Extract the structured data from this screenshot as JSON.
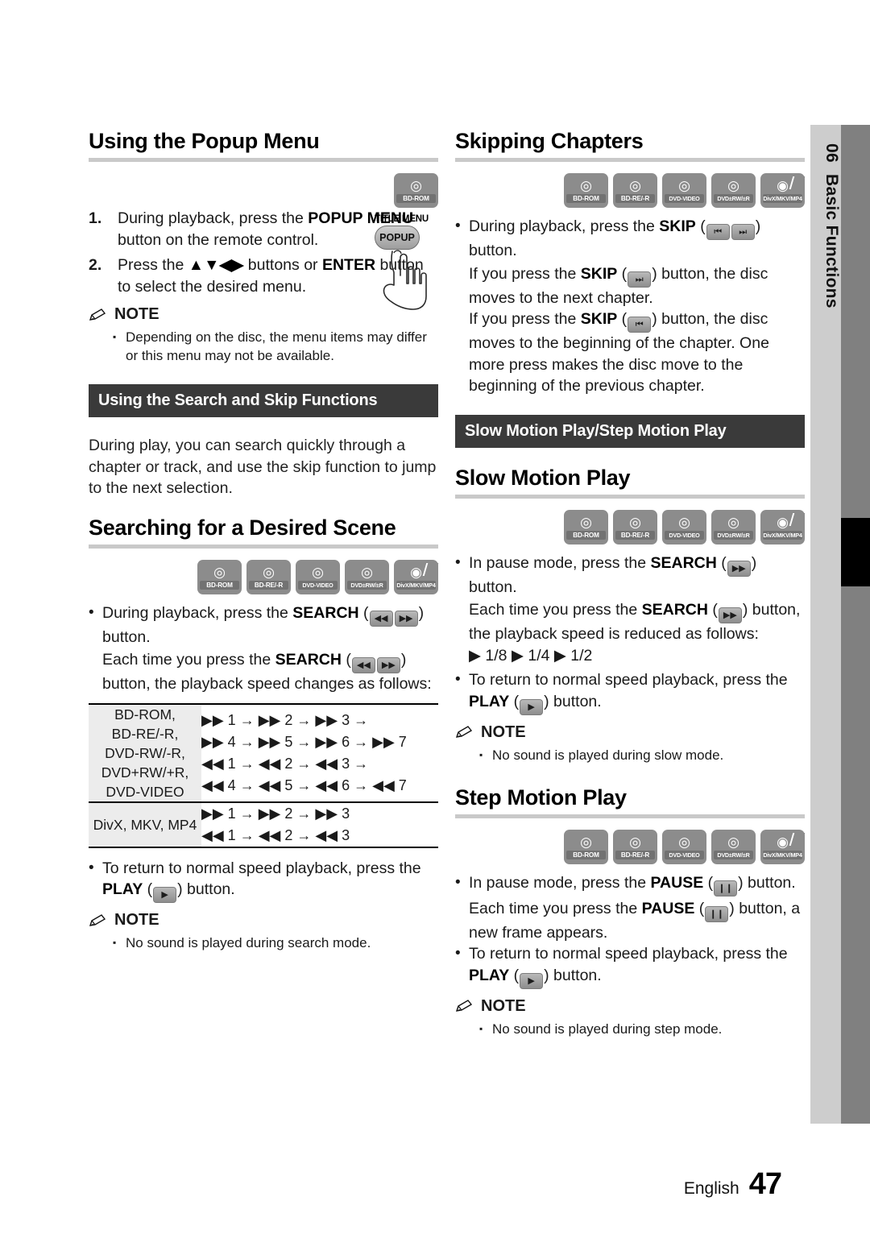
{
  "page": {
    "chapter_number": "06",
    "chapter_name": "Basic Functions",
    "language": "English",
    "page_number": "47"
  },
  "left_column": {
    "section1": {
      "title": "Using the Popup Menu",
      "disc_icons": [
        "BD-ROM"
      ],
      "steps": [
        {
          "num": "1.",
          "text_a": "During playback, press the ",
          "bold_a": "POPUP MENU",
          "text_b": " button on the remote control."
        },
        {
          "num": "2.",
          "text_a": "Press the ",
          "arrows": "▲▼◀▶",
          "text_b": " buttons or ",
          "bold_b": "ENTER",
          "text_c": " button to select the desired menu."
        }
      ],
      "remote_graphic": {
        "label": "TITLE MENU",
        "button": "POPUP"
      },
      "note": {
        "heading": "NOTE",
        "items": [
          "Depending on the disc, the menu items may differ or this menu may not be available."
        ]
      }
    },
    "section2": {
      "bar_title": "Using the Search and Skip Functions",
      "intro": "During play, you can search quickly through a chapter or track, and use the skip function to jump to the next selection."
    },
    "section3": {
      "title": "Searching for a Desired Scene",
      "disc_icons": [
        "BD-ROM",
        "BD-RE/-R",
        "DVD-VIDEO",
        "DVD±RW/±R",
        "DivX/MKV/MP4"
      ],
      "bullets": [
        {
          "pre": "During playback, press the ",
          "bold": "SEARCH",
          "keys": [
            "rewind",
            "fastforward"
          ],
          "post": " button."
        }
      ],
      "sub_line": {
        "pre": "Each time you press the ",
        "bold": "SEARCH",
        "keys": [
          "rewind",
          "fastforward"
        ],
        "post": " button, the playback speed changes as follows:"
      },
      "speed_table": {
        "rows": [
          {
            "category": "BD-ROM,\nBD-RE/-R,\nDVD-RW/-R,\nDVD+RW/+R,\nDVD-VIDEO",
            "sequences": [
              "▶▶ 1 → ▶▶ 2 → ▶▶ 3 →",
              "▶▶ 4 → ▶▶ 5 → ▶▶ 6 → ▶▶ 7",
              "◀◀ 1 → ◀◀ 2 → ◀◀ 3 →",
              "◀◀ 4 → ◀◀ 5 → ◀◀ 6 → ◀◀ 7"
            ]
          },
          {
            "category": "DivX, MKV, MP4",
            "sequences": [
              "▶▶ 1 → ▶▶ 2 → ▶▶ 3",
              "◀◀ 1 → ◀◀ 2 → ◀◀ 3"
            ]
          }
        ]
      },
      "return_bullet": {
        "pre": "To return to normal speed playback, press the ",
        "bold": "PLAY",
        "keys": [
          "play"
        ],
        "post": " button."
      },
      "note": {
        "heading": "NOTE",
        "items": [
          "No sound is played during search mode."
        ]
      }
    }
  },
  "right_column": {
    "section1": {
      "title": "Skipping Chapters",
      "disc_icons": [
        "BD-ROM",
        "BD-RE/-R",
        "DVD-VIDEO",
        "DVD±RW/±R",
        "DivX/MKV/MP4"
      ],
      "bullet": {
        "pre": "During playback, press the ",
        "bold": "SKIP",
        "keys": [
          "skipback",
          "skipfwd"
        ],
        "post": " button."
      },
      "lines": [
        {
          "pre": "If you press the ",
          "bold": "SKIP",
          "keys": [
            "skipfwd"
          ],
          "post": " button, the disc moves to the next chapter."
        },
        {
          "pre": "If you press the ",
          "bold": "SKIP",
          "keys": [
            "skipback"
          ],
          "post": " button, the disc moves to the beginning of the chapter. One more press makes the disc move to the beginning of the previous chapter."
        }
      ]
    },
    "section2": {
      "bar_title": "Slow Motion Play/Step Motion Play"
    },
    "section3": {
      "title": "Slow Motion Play",
      "disc_icons": [
        "BD-ROM",
        "BD-RE/-R",
        "DVD-VIDEO",
        "DVD±RW/±R",
        "DivX/MKV/MP4"
      ],
      "bullet": {
        "pre": "In pause mode, press the ",
        "bold": "SEARCH",
        "keys": [
          "fastforward"
        ],
        "post": " button."
      },
      "sub_line": {
        "pre": "Each time you press the ",
        "bold": "SEARCH",
        "keys": [
          "fastforward"
        ],
        "post": " button, the playback speed is reduced as follows:"
      },
      "speeds": "▶ 1/8 ▶ 1/4 ▶ 1/2",
      "return_bullet": {
        "pre": "To return to normal speed playback, press the ",
        "bold": "PLAY",
        "keys": [
          "play"
        ],
        "post": " button."
      },
      "note": {
        "heading": "NOTE",
        "items": [
          "No sound is played during slow mode."
        ]
      }
    },
    "section4": {
      "title": "Step Motion Play",
      "disc_icons": [
        "BD-ROM",
        "BD-RE/-R",
        "DVD-VIDEO",
        "DVD±RW/±R",
        "DivX/MKV/MP4"
      ],
      "bullet": {
        "pre": "In pause mode, press the ",
        "bold": "PAUSE",
        "keys": [
          "pause"
        ],
        "post": " button."
      },
      "sub_line": {
        "pre": "Each time you press the ",
        "bold": "PAUSE",
        "keys": [
          "pause"
        ],
        "post": " button, a new frame appears."
      },
      "return_bullet": {
        "pre": "To return to normal speed playback, press the ",
        "bold": "PLAY",
        "keys": [
          "play"
        ],
        "post": " button."
      },
      "note": {
        "heading": "NOTE",
        "items": [
          "No sound is played during step mode."
        ]
      }
    }
  },
  "icons": {
    "disc_glyph": "◎",
    "divx_glyph": "◉",
    "note_pencil": "✎",
    "bullet_dot": "•",
    "note_square": "▪",
    "key_rewind": "◀◀",
    "key_fastforward": "▶▶",
    "key_skipback": "⏮",
    "key_skipfwd": "⏭",
    "key_play": "▶",
    "key_pause": "❙❙"
  }
}
